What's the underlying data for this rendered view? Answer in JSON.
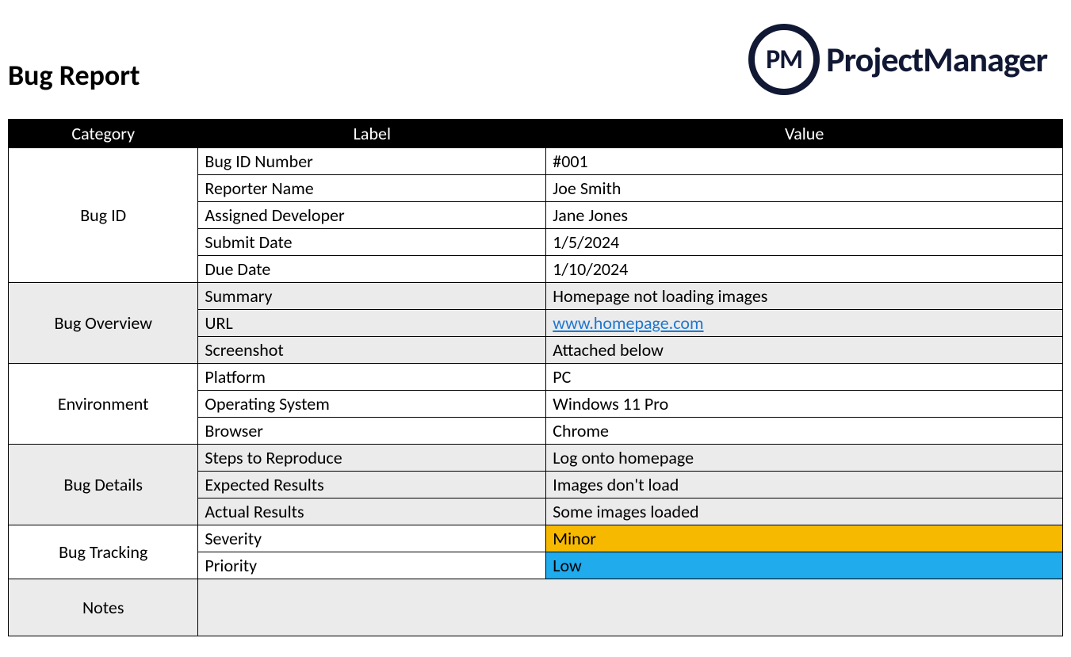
{
  "header": {
    "title": "Bug Report",
    "logo_abbr": "PM",
    "logo_text": "ProjectManager"
  },
  "table": {
    "col_category": "Category",
    "col_label": "Label",
    "col_value": "Value"
  },
  "sections": {
    "bug_id": {
      "name": "Bug ID",
      "rows": [
        {
          "label": "Bug ID Number",
          "value": "#001"
        },
        {
          "label": "Reporter Name",
          "value": "Joe Smith"
        },
        {
          "label": "Assigned Developer",
          "value": "Jane Jones"
        },
        {
          "label": "Submit Date",
          "value": "1/5/2024"
        },
        {
          "label": "Due Date",
          "value": "1/10/2024"
        }
      ]
    },
    "bug_overview": {
      "name": "Bug Overview",
      "rows": [
        {
          "label": "Summary",
          "value": "Homepage not loading images"
        },
        {
          "label": "URL",
          "value": "www.homepage.com",
          "link": true
        },
        {
          "label": "Screenshot",
          "value": "Attached below"
        }
      ]
    },
    "environment": {
      "name": "Environment",
      "rows": [
        {
          "label": "Platform",
          "value": "PC"
        },
        {
          "label": "Operating System",
          "value": "Windows 11 Pro"
        },
        {
          "label": "Browser",
          "value": "Chrome"
        }
      ]
    },
    "bug_details": {
      "name": "Bug Details",
      "rows": [
        {
          "label": "Steps to Reproduce",
          "value": "Log onto homepage"
        },
        {
          "label": "Expected Results",
          "value": "Images don't load"
        },
        {
          "label": "Actual Results",
          "value": "Some images loaded"
        }
      ]
    },
    "bug_tracking": {
      "name": "Bug Tracking",
      "rows": [
        {
          "label": "Severity",
          "value": "Minor"
        },
        {
          "label": "Priority",
          "value": "Low"
        }
      ]
    },
    "notes": {
      "name": "Notes",
      "value": ""
    }
  }
}
